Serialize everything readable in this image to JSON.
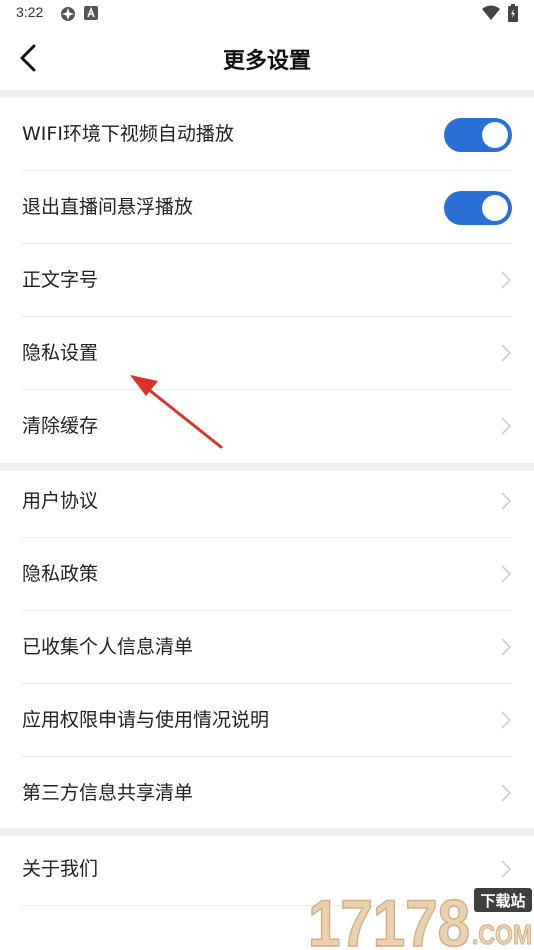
{
  "status_bar": {
    "time": "3:22"
  },
  "header": {
    "title": "更多设置"
  },
  "sections": [
    {
      "rows": [
        {
          "label": "WIFI环境下视频自动播放",
          "type": "toggle",
          "on": true
        },
        {
          "label": "退出直播间悬浮播放",
          "type": "toggle",
          "on": true
        },
        {
          "label": "正文字号",
          "type": "link"
        },
        {
          "label": "隐私设置",
          "type": "link"
        },
        {
          "label": "清除缓存",
          "type": "link"
        }
      ]
    },
    {
      "rows": [
        {
          "label": "用户协议",
          "type": "link"
        },
        {
          "label": "隐私政策",
          "type": "link"
        },
        {
          "label": "已收集个人信息清单",
          "type": "link"
        },
        {
          "label": "应用权限申请与使用情况说明",
          "type": "link"
        },
        {
          "label": "第三方信息共享清单",
          "type": "link"
        }
      ]
    },
    {
      "rows": [
        {
          "label": "关于我们",
          "type": "link"
        }
      ]
    }
  ],
  "watermark": {
    "number": "17178",
    "tag": "下载站",
    "domain": ".COM"
  },
  "colors": {
    "toggle_on": "#2a6fd6",
    "annotation_arrow": "#d8322a",
    "section_gap": "#efefef"
  }
}
